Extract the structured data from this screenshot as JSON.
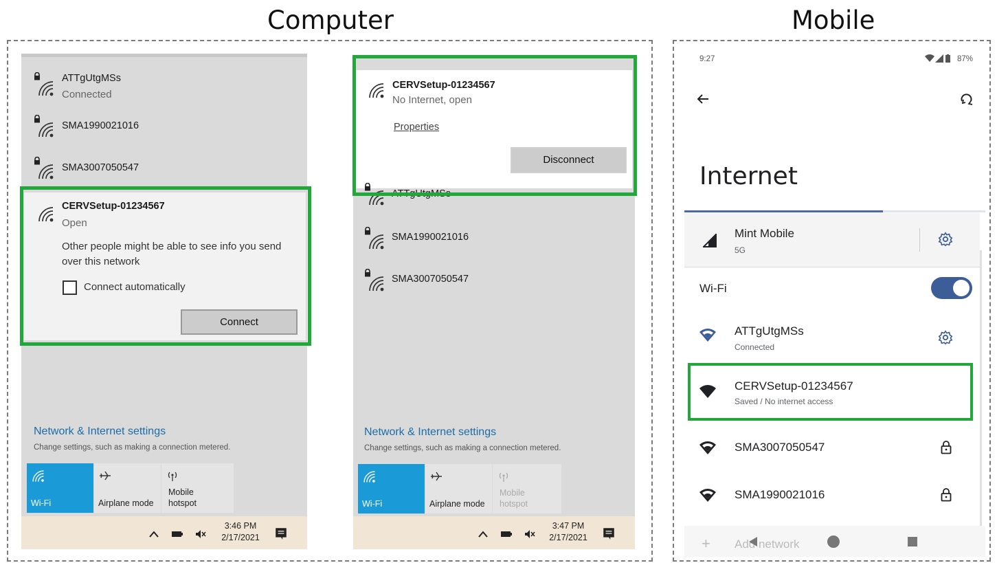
{
  "labels": {
    "computer": "Computer",
    "mobile": "Mobile"
  },
  "colors": {
    "highlight": "#22a83a",
    "win_accent": "#1a9ad6",
    "link": "#1b6ca8",
    "android_toggle": "#3d5d99"
  },
  "win_left": {
    "networks": [
      {
        "name": "ATTgUtgMSs",
        "status": "Connected",
        "secured": true
      },
      {
        "name": "SMA1990021016",
        "secured": true
      },
      {
        "name": "SMA3007050547",
        "secured": true
      }
    ],
    "expanded": {
      "name": "CERVSetup-01234567",
      "status": "Open",
      "warning": "Other people might be able to see info you send over this network",
      "checkbox_label": "Connect automatically",
      "button": "Connect"
    },
    "settings_title": "Network & Internet settings",
    "settings_sub": "Change settings, such as making a connection metered.",
    "tiles": [
      {
        "label": "Wi-Fi",
        "icon": "wifi-icon",
        "active": true
      },
      {
        "label": "Airplane mode",
        "icon": "airplane-icon"
      },
      {
        "label": "Mobile hotspot",
        "label_line1": "Mobile",
        "label_line2": "hotspot",
        "icon": "hotspot-icon"
      }
    ],
    "time": "3:46 PM",
    "date": "2/17/2021"
  },
  "win_right": {
    "expanded": {
      "name": "CERVSetup-01234567",
      "status": "No Internet, open",
      "link": "Properties",
      "button": "Disconnect"
    },
    "networks": [
      {
        "name": "ATTgUtgMSs",
        "secured": true
      },
      {
        "name": "SMA1990021016",
        "secured": true
      },
      {
        "name": "SMA3007050547",
        "secured": true
      }
    ],
    "settings_title": "Network & Internet settings",
    "settings_sub": "Change settings, such as making a connection metered.",
    "tiles": [
      {
        "label": "Wi-Fi",
        "icon": "wifi-icon",
        "active": true
      },
      {
        "label": "Airplane mode",
        "icon": "airplane-icon"
      },
      {
        "label_line1": "Mobile",
        "label_line2": "hotspot",
        "icon": "hotspot-icon",
        "disabled": true
      }
    ],
    "time": "3:47 PM",
    "date": "2/17/2021"
  },
  "android": {
    "status_time": "9:27",
    "battery": "87%",
    "title": "Internet",
    "mobile": {
      "name": "Mint Mobile",
      "sub": "5G"
    },
    "wifi_label": "Wi-Fi",
    "wifi_on": true,
    "networks": [
      {
        "name": "ATTgUtgMSs",
        "sub": "Connected",
        "action": "gear-icon"
      },
      {
        "name": "CERVSetup-01234567",
        "sub": "Saved / No internet access"
      },
      {
        "name": "SMA3007050547",
        "action": "lock-icon"
      },
      {
        "name": "SMA1990021016",
        "action": "lock-icon"
      }
    ],
    "add_network": "Add network"
  }
}
